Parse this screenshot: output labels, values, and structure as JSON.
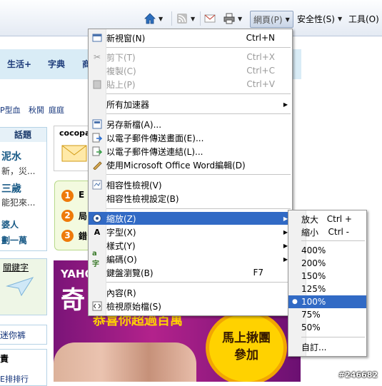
{
  "toolbar": {
    "page_label": "網頁(P)",
    "safety_label": "安全性(S)",
    "tools_label": "工具(O)"
  },
  "background_page": {
    "nav_tabs": [
      "生活+",
      "字典",
      "商"
    ],
    "category_links": [
      "P型血",
      "秋鬨",
      "庭庭"
    ],
    "topic_header": "話題",
    "topic_items": [
      "泥水",
      "新，災...",
      "三歲",
      "能犯來...",
      "婆人",
      "劃一萬"
    ],
    "keyword_label": "關鍵字",
    "skirt_label": "迷你裤",
    "misc_label": "責",
    "ranking_label": "E排排行",
    "cocopa_label": "cocopa",
    "promo_numbers": [
      "1",
      "2",
      "3"
    ],
    "promo_letters": [
      "E",
      "局",
      "錯"
    ],
    "ad": {
      "logo": "YAHOO!",
      "logo_sub": "奇",
      "headline": "恭喜你超過百萬",
      "cta_line1": "馬上揪團",
      "cta_line2": "參加"
    },
    "watermark": "#246682"
  },
  "page_menu": {
    "items": [
      {
        "label": "新視窗(N)",
        "shortcut": "Ctrl+N",
        "icon": "new-window-icon",
        "disabled": false
      },
      {
        "label": "剪下(T)",
        "shortcut": "Ctrl+X",
        "icon": "scissors-icon",
        "disabled": true
      },
      {
        "label": "複製(C)",
        "shortcut": "Ctrl+C",
        "icon": "copy-icon",
        "disabled": true
      },
      {
        "label": "貼上(P)",
        "shortcut": "Ctrl+V",
        "icon": "paste-icon",
        "disabled": true
      },
      {
        "label": "所有加速器",
        "shortcut": "",
        "icon": "",
        "disabled": false,
        "submenu": true
      },
      {
        "label": "另存新檔(A)...",
        "shortcut": "",
        "icon": "save-icon",
        "disabled": false
      },
      {
        "label": "以電子郵件傳送畫面(E)...",
        "shortcut": "",
        "icon": "email-page-icon",
        "disabled": false
      },
      {
        "label": "以電子郵件傳送連結(L)...",
        "shortcut": "",
        "icon": "email-link-icon",
        "disabled": false
      },
      {
        "label": "使用Microsoft Office Word編輯(D)",
        "shortcut": "",
        "icon": "word-edit-icon",
        "disabled": false
      },
      {
        "label": "相容性檢視(V)",
        "shortcut": "",
        "icon": "compat-view-icon",
        "disabled": false
      },
      {
        "label": "相容性檢視設定(B)",
        "shortcut": "",
        "icon": "",
        "disabled": false
      },
      {
        "label": "縮放(Z)",
        "shortcut": "",
        "icon": "zoom-icon",
        "disabled": false,
        "submenu": true,
        "highlighted": true
      },
      {
        "label": "字型(X)",
        "shortcut": "",
        "icon": "",
        "disabled": false,
        "submenu": true
      },
      {
        "label": "樣式(Y)",
        "shortcut": "",
        "icon": "",
        "disabled": false,
        "submenu": true
      },
      {
        "label": "編碼(O)",
        "shortcut": "",
        "icon": "encoding-icon",
        "disabled": false,
        "submenu": true
      },
      {
        "label": "鍵盤瀏覽(B)",
        "shortcut": "F7",
        "icon": "",
        "disabled": false
      },
      {
        "label": "內容(R)",
        "shortcut": "",
        "icon": "",
        "disabled": false
      },
      {
        "label": "檢視原始檔(S)",
        "shortcut": "",
        "icon": "view-source-icon",
        "disabled": false
      }
    ]
  },
  "zoom_menu": {
    "items": [
      {
        "label": "放大",
        "shortcut": "Ctrl +"
      },
      {
        "label": "縮小",
        "shortcut": "Ctrl -"
      },
      {
        "label": "400%"
      },
      {
        "label": "200%"
      },
      {
        "label": "150%"
      },
      {
        "label": "125%"
      },
      {
        "label": "100%",
        "selected": true
      },
      {
        "label": "75%"
      },
      {
        "label": "50%"
      },
      {
        "label": "自訂..."
      }
    ]
  },
  "colors": {
    "highlight": "#316ac5",
    "menu_border": "#979797",
    "ad_purple": "#b3228c"
  }
}
